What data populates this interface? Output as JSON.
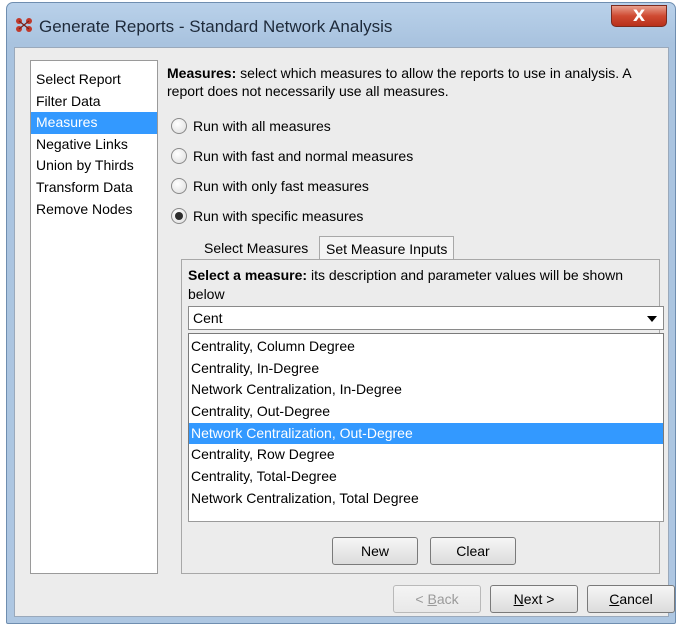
{
  "window": {
    "title": "Generate Reports - Standard Network Analysis",
    "close_label": "X"
  },
  "nav": {
    "items": [
      {
        "label": "Select Report"
      },
      {
        "label": "Filter Data"
      },
      {
        "label": "Measures",
        "selected": true
      },
      {
        "label": "Negative Links"
      },
      {
        "label": "Union by Thirds"
      },
      {
        "label": "Transform Data"
      },
      {
        "label": "Remove Nodes"
      }
    ]
  },
  "measures": {
    "heading": "Measures:",
    "description": " select which measures to allow the reports to use in analysis. A report does not necessarily use all measures.",
    "options": [
      {
        "label": "Run with all measures",
        "checked": false
      },
      {
        "label": "Run with fast and normal measures",
        "checked": false
      },
      {
        "label": "Run with only fast measures",
        "checked": false
      },
      {
        "label": "Run with specific measures",
        "checked": true
      }
    ]
  },
  "tabs": [
    {
      "label": "Select Measures",
      "active": false
    },
    {
      "label": "Set Measure Inputs",
      "active": true
    }
  ],
  "panel": {
    "heading": "Select a measure:",
    "description": " its description and parameter values will be shown below",
    "combo_value": "Cent",
    "dropdown_items": [
      "Centrality, Column Degree",
      "Centrality, In-Degree",
      "Network Centralization, In-Degree",
      "Centrality, Out-Degree",
      "Network Centralization, Out-Degree",
      "Centrality, Row Degree",
      "Centrality, Total-Degree",
      "Network Centralization, Total Degree"
    ],
    "selected_item": "Network Centralization, Out-Degree",
    "new_label": "New",
    "clear_label": "Clear"
  },
  "footer": {
    "back": {
      "prefix": "< ",
      "mnemonic": "B",
      "rest": "ack",
      "disabled": true
    },
    "next": {
      "prefix": "",
      "mnemonic": "N",
      "rest": "ext >"
    },
    "cancel": {
      "prefix": "",
      "mnemonic": "C",
      "rest": "ancel"
    }
  },
  "colors": {
    "selection": "#3399ff",
    "titlebar": "#b9d1ea",
    "close_button": "#cf4a32",
    "client_background": "#ececec"
  },
  "icons": [
    "app-icon",
    "close-icon",
    "radio-icon",
    "dropdown-arrow-icon"
  ]
}
